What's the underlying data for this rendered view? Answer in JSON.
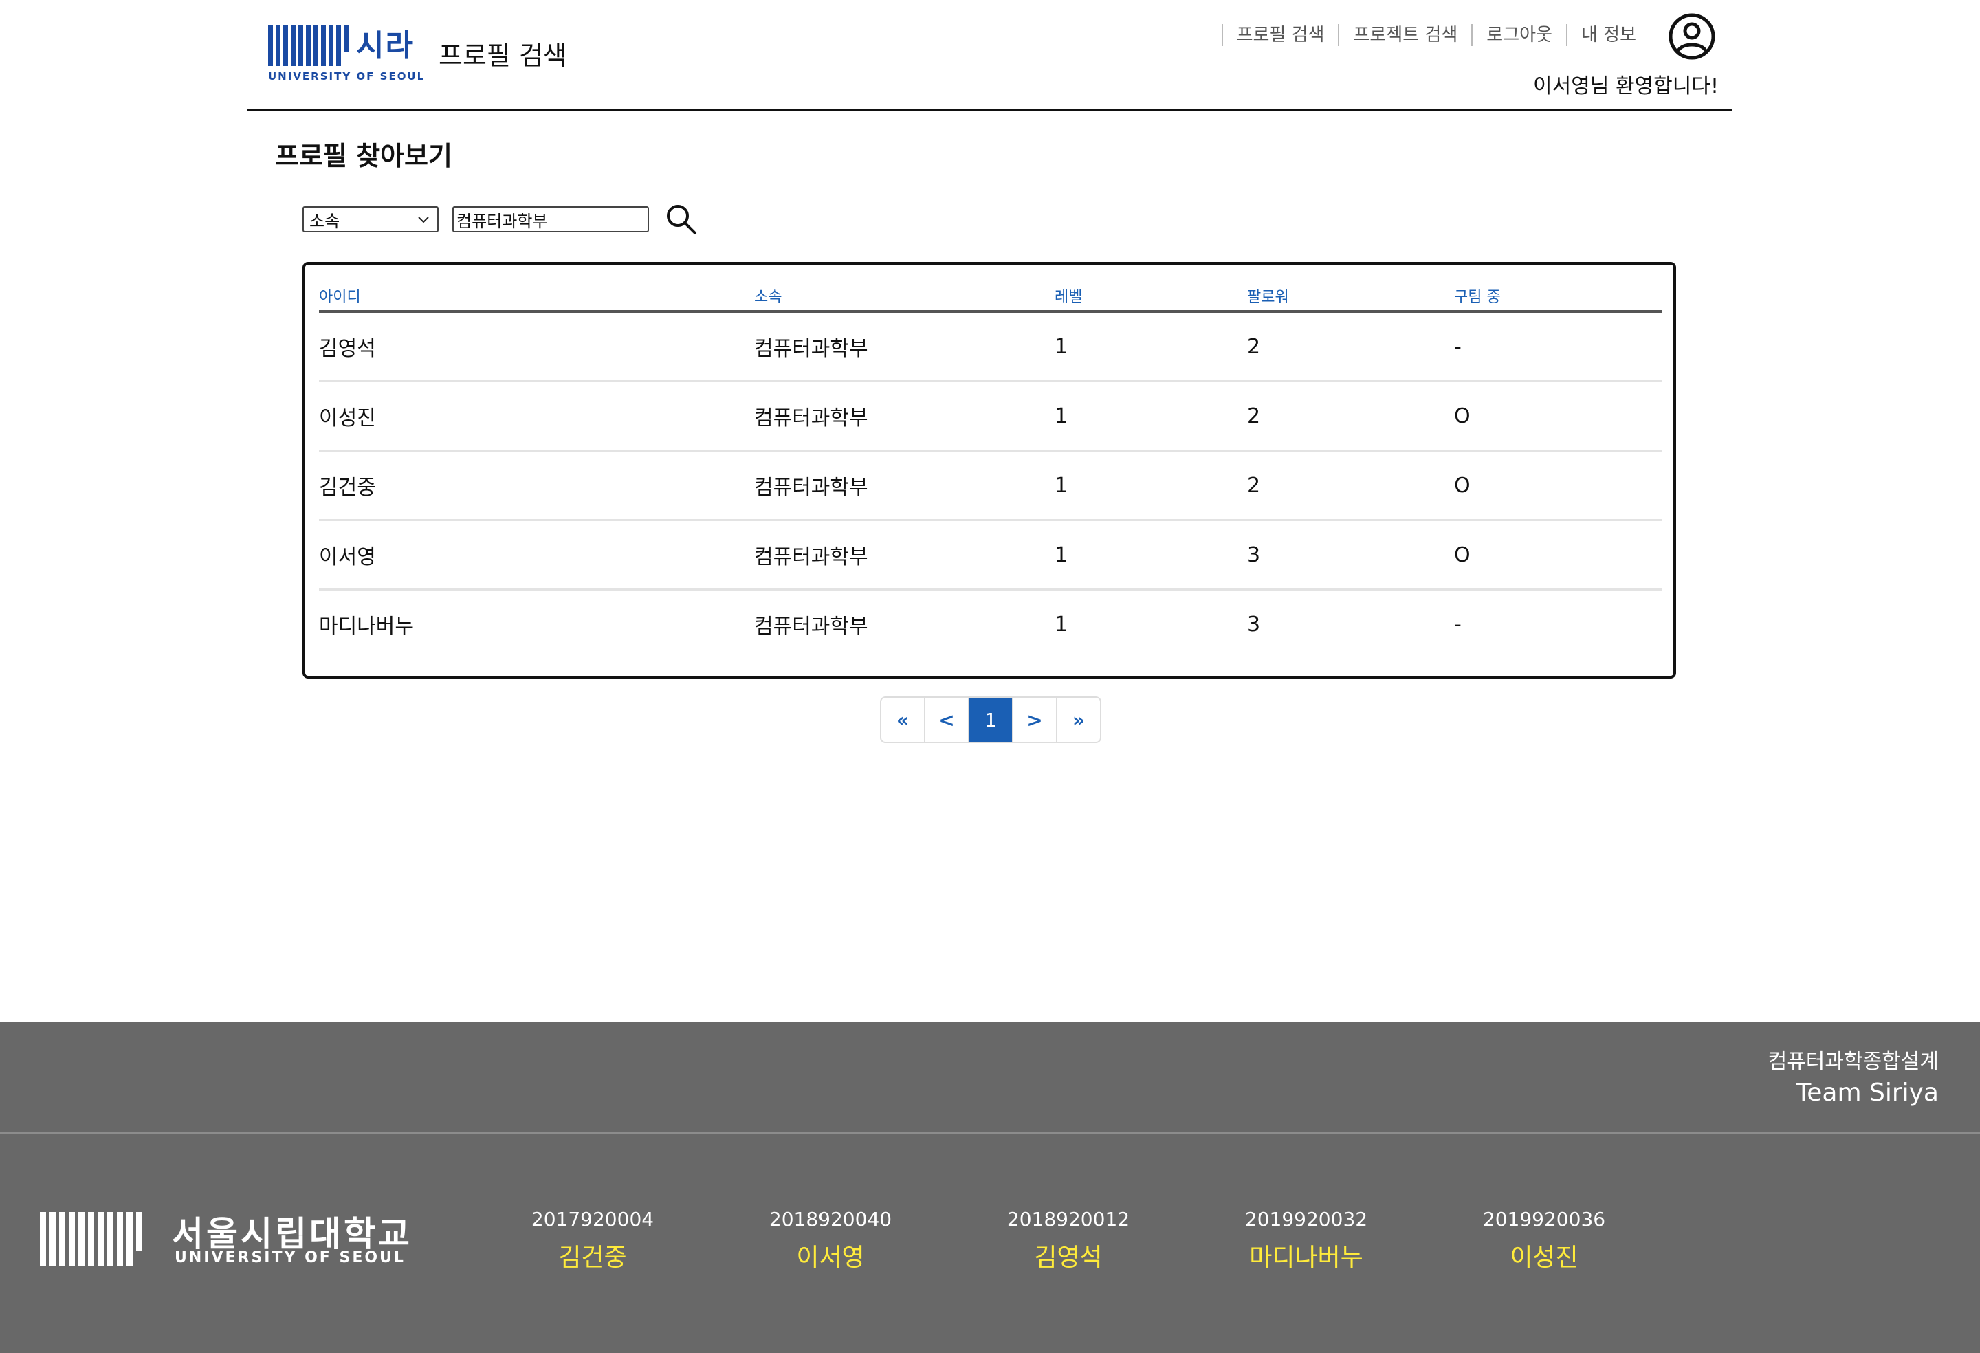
{
  "header": {
    "logo_korean": "시라",
    "logo_english": "UNIVERSITY OF SEOUL",
    "page_heading": "프로필 검색",
    "nav": [
      "프로필 검색",
      "프로젝트 검색",
      "로그아웃",
      "내 정보"
    ],
    "welcome": "이서영님 환영합니다!",
    "user_icon": "user-circle-icon",
    "brand_color": "#1a4aa3"
  },
  "main": {
    "title": "프로필 찾아보기",
    "filter": {
      "selected": "소속"
    },
    "search": {
      "value": "컴퓨터과학부",
      "icon": "search-icon"
    },
    "table": {
      "headers": [
        "아이디",
        "소속",
        "레벨",
        "팔로워",
        "구팀 중"
      ],
      "rows": [
        [
          "김영석",
          "컴퓨터과학부",
          "1",
          "2",
          "-"
        ],
        [
          "이성진",
          "컴퓨터과학부",
          "1",
          "2",
          "O"
        ],
        [
          "김건중",
          "컴퓨터과학부",
          "1",
          "2",
          "O"
        ],
        [
          "이서영",
          "컴퓨터과학부",
          "1",
          "3",
          "O"
        ],
        [
          "마디나버누",
          "컴퓨터과학부",
          "1",
          "3",
          "-"
        ]
      ],
      "header_color": "#1a5fb4"
    },
    "pagination": [
      "«",
      "<",
      "1",
      ">",
      "»"
    ],
    "current_page": "1"
  },
  "footer": {
    "course": "컴퓨터과학종합설계",
    "team": "Team Siriya",
    "university_korean": "서울시립대학교",
    "university_english": "UNIVERSITY OF SEOUL",
    "members": [
      {
        "id": "2017920004",
        "name": "김건중"
      },
      {
        "id": "2018920040",
        "name": "이서영"
      },
      {
        "id": "2018920012",
        "name": "김영석"
      },
      {
        "id": "2019920032",
        "name": "마디나버누"
      },
      {
        "id": "2019920036",
        "name": "이성진"
      }
    ],
    "background": "#686868",
    "name_color": "#ffeb3b"
  }
}
